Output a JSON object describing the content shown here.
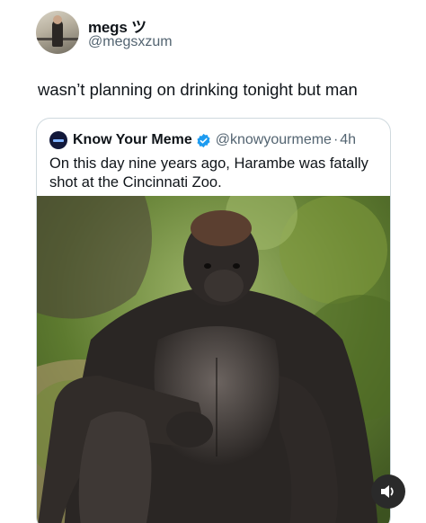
{
  "post": {
    "author": {
      "display_name": "megs ツ",
      "handle": "@megsxzum"
    },
    "text": "wasn’t planning on drinking tonight but man",
    "quoted_tweet": {
      "author_name": "Know Your Meme",
      "verified": true,
      "handle": "@knowyourmeme",
      "separator": "·",
      "time": "4h",
      "text": "On this day nine years ago, Harambe was fatally shot at the Cincinnati Zoo.",
      "media": {
        "icon": "gorilla-photo"
      }
    }
  },
  "controls": {
    "sound_icon": "speaker-volume-icon"
  },
  "colors": {
    "verified_blue": "#1d9bf0",
    "secondary_text": "#536471",
    "border": "#cfd9de",
    "foliage": "#5d7a2f",
    "gorilla": "#2a2624"
  }
}
